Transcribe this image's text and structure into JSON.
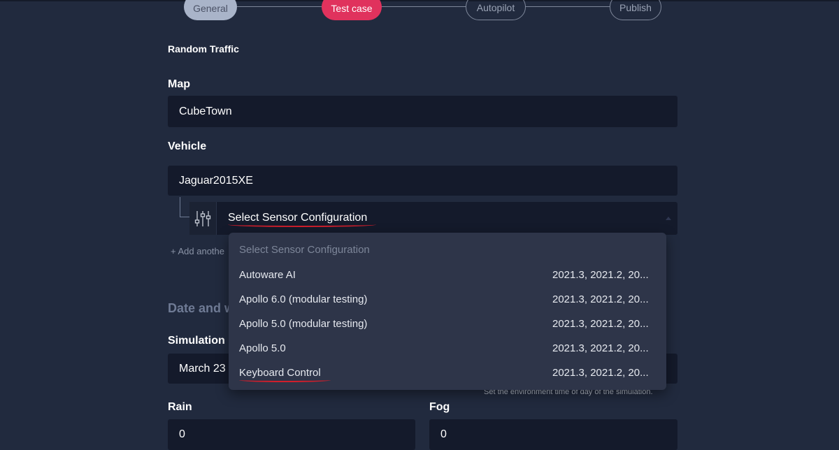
{
  "stepper": {
    "steps": [
      {
        "label": "General",
        "state": "done"
      },
      {
        "label": "Test case",
        "state": "active"
      },
      {
        "label": "Autopilot",
        "state": "pending"
      },
      {
        "label": "Publish",
        "state": "pending"
      }
    ]
  },
  "form": {
    "random_traffic_label": "Random Traffic",
    "map_label": "Map",
    "map_value": "CubeTown",
    "vehicle_label": "Vehicle",
    "vehicle_value": "Jaguar2015XE",
    "sensor_config_value": "Select Sensor Configuration",
    "add_another_label": "+ Add anothe",
    "date_section_title": "Date and w",
    "simulation_label": "Simulation",
    "simulation_date_value": "March 23",
    "time_helper_text": "Set the environment time of day of the simulation.",
    "rain_label": "Rain",
    "rain_value": "0",
    "fog_label": "Fog",
    "fog_value": "0"
  },
  "dropdown": {
    "placeholder": "Select Sensor Configuration",
    "items": [
      {
        "name": "Autoware AI",
        "versions": "2021.3, 2021.2, 20..."
      },
      {
        "name": "Apollo 6.0 (modular testing)",
        "versions": "2021.3, 2021.2, 20..."
      },
      {
        "name": "Apollo 5.0 (modular testing)",
        "versions": "2021.3, 2021.2, 20..."
      },
      {
        "name": "Apollo 5.0",
        "versions": "2021.3, 2021.2, 20..."
      },
      {
        "name": "Keyboard Control",
        "versions": "2021.3, 2021.2, 20..."
      }
    ]
  },
  "colors": {
    "background": "#212a3e",
    "field_bg": "#141a2b",
    "accent": "#e0325d",
    "annotation_red": "#d21e2b",
    "dropdown_bg": "#2e3549"
  },
  "icons": {
    "sensor_config": "sliders-icon"
  }
}
